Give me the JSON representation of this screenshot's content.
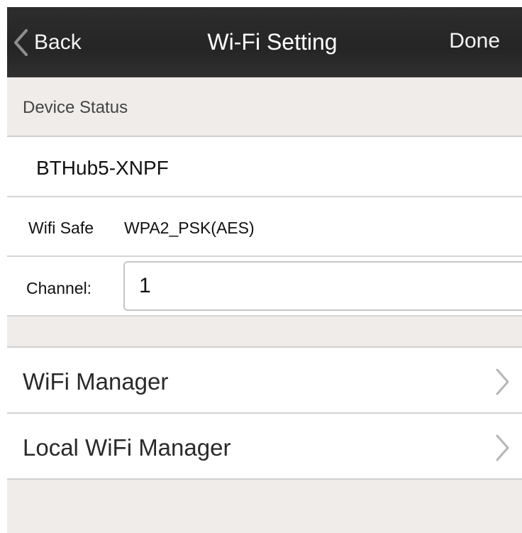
{
  "navbar": {
    "back_label": "Back",
    "title": "Wi-Fi Setting",
    "done_label": "Done"
  },
  "device_status": {
    "header": "Device Status",
    "ssid": "BTHub5-XNPF",
    "wifi_safe_label": "Wifi Safe",
    "wifi_safe_value": "WPA2_PSK(AES)",
    "channel_label": "Channel:",
    "channel_value": "1"
  },
  "menu": {
    "items": [
      {
        "label": "WiFi Manager",
        "icon": "chevron-right-icon"
      },
      {
        "label": "Local WiFi Manager",
        "icon": "chevron-right-icon"
      }
    ]
  },
  "colors": {
    "navbar_bg": "#2a2a2a",
    "section_bg": "#efecea",
    "separator": "#d0d0d0",
    "chevron": "#b5b5b5"
  }
}
